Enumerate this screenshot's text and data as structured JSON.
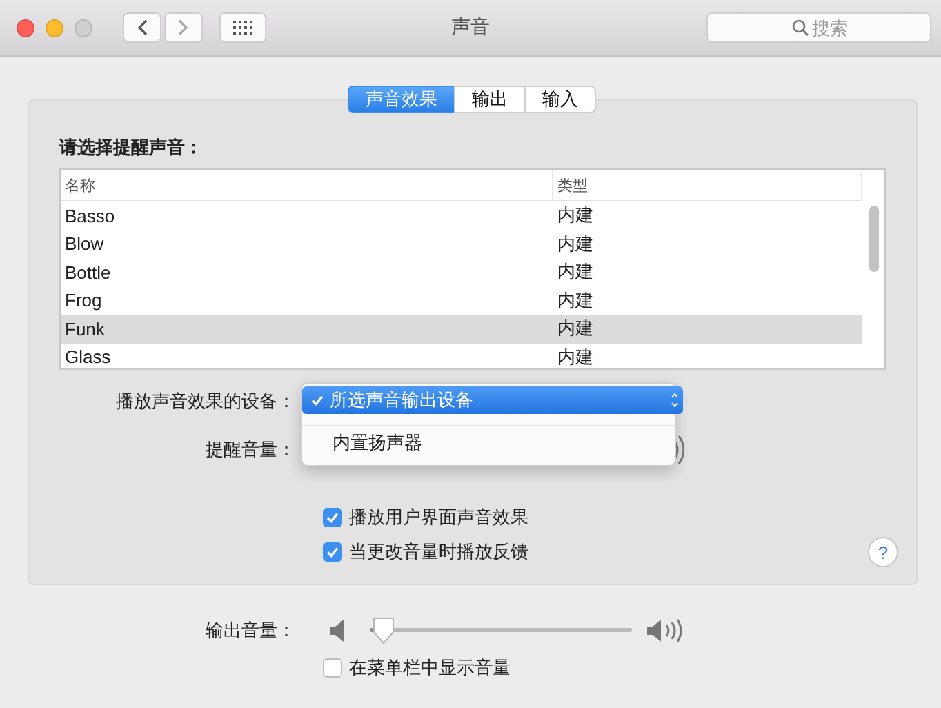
{
  "window": {
    "title": "声音"
  },
  "search": {
    "placeholder": "搜索"
  },
  "tabs": [
    {
      "label": "声音效果",
      "selected": true
    },
    {
      "label": "输出",
      "selected": false
    },
    {
      "label": "输入",
      "selected": false
    }
  ],
  "alert_sound": {
    "label": "请选择提醒声音：",
    "columns": [
      "名称",
      "类型"
    ],
    "rows": [
      {
        "name": "Basso",
        "type": "内建",
        "selected": false
      },
      {
        "name": "Blow",
        "type": "内建",
        "selected": false
      },
      {
        "name": "Bottle",
        "type": "内建",
        "selected": false
      },
      {
        "name": "Frog",
        "type": "内建",
        "selected": false
      },
      {
        "name": "Funk",
        "type": "内建",
        "selected": true
      },
      {
        "name": "Glass",
        "type": "内建",
        "selected": false
      }
    ]
  },
  "device": {
    "label": "播放声音效果的设备：",
    "options": [
      {
        "label": "所选声音输出设备",
        "selected": true
      },
      {
        "label": "内置扬声器",
        "selected": false
      }
    ]
  },
  "alert_volume": {
    "label": "提醒音量："
  },
  "options": [
    {
      "label": "播放用户界面声音效果",
      "checked": true
    },
    {
      "label": "当更改音量时播放反馈",
      "checked": true
    }
  ],
  "help": "?",
  "output_volume": {
    "label": "输出音量：",
    "level": 0.05
  },
  "menu_bar_volume": {
    "label": "在菜单栏中显示音量",
    "checked": false
  }
}
